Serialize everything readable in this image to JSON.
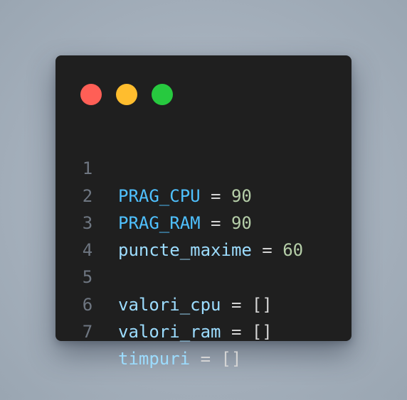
{
  "window": {
    "controls": [
      {
        "name": "close",
        "color": "#ff5f56"
      },
      {
        "name": "minimize",
        "color": "#ffbd2e"
      },
      {
        "name": "maximize",
        "color": "#27c93f"
      }
    ]
  },
  "code": {
    "lines": [
      {
        "number": "1",
        "name": "PRAG_CPU",
        "op": " = ",
        "value": "90"
      },
      {
        "number": "2",
        "name": "PRAG_RAM",
        "op": " = ",
        "value": "90"
      },
      {
        "number": "3",
        "name": "puncte_maxime",
        "op": " = ",
        "value": "60"
      },
      {
        "number": "4",
        "name": "",
        "op": "",
        "value": ""
      },
      {
        "number": "5",
        "name": "valori_cpu",
        "op": " = ",
        "value": "[]"
      },
      {
        "number": "6",
        "name": "valori_ram",
        "op": " = ",
        "value": "[]"
      },
      {
        "number": "7",
        "name": "timpuri",
        "op": " = ",
        "value": "[]"
      }
    ]
  },
  "colors": {
    "background": "#a4afbb",
    "editor": "#1f1f1f",
    "line_number": "#6e7681",
    "constant": "#4fc1ff",
    "variable": "#9cdcfe",
    "operator": "#d4d4d4",
    "number": "#b5cea8"
  }
}
